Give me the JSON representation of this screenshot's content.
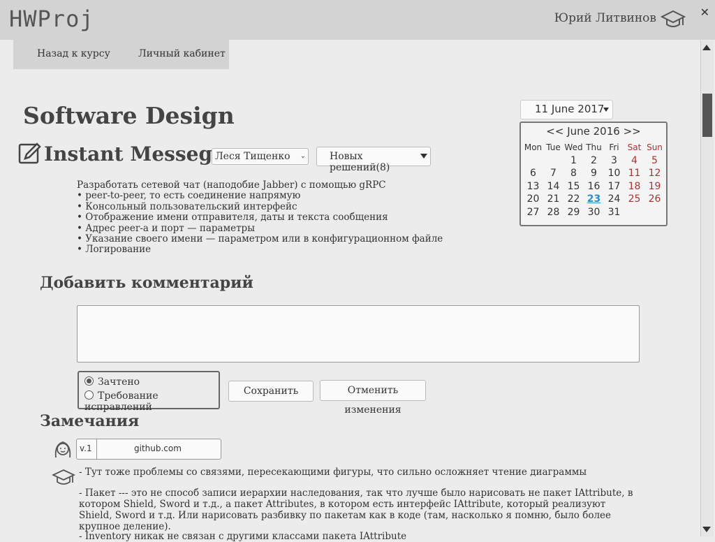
{
  "app": {
    "logo": "HWProj",
    "user_name": "Юрий Литвинов"
  },
  "nav": {
    "back_label": "Назад к курсу",
    "cabinet_label": "Личный кабинет"
  },
  "course": {
    "title": "Software Design"
  },
  "task": {
    "title": "Instant Messeger",
    "student_select": "Леся Тищенко",
    "solutions_select": "Новых решений(8)",
    "description": [
      "Разработать сетевой чат (наподобие Jabber) с помощью gRPC",
      "• peer-to-peer, то есть соединение напрямую",
      "• Консольный пользовательский интерфейс",
      "• Отображение имени отправителя, даты и текста сообщения",
      "• Адрес peer-а и порт — параметры",
      "• Указание своего имени — параметром или в конфигурационном файле",
      "• Логирование"
    ]
  },
  "date_picker": {
    "value": "11 June 2017"
  },
  "calendar": {
    "prev": "<<",
    "month_label": "June 2016",
    "next": ">>",
    "weekdays": [
      "Mon",
      "Tue",
      "Wed",
      "Thu",
      "Fri",
      "Sat",
      "Sun"
    ],
    "weeks": [
      [
        "",
        "",
        "",
        "1",
        "2",
        "3",
        "4",
        "5"
      ],
      [
        "6",
        "7",
        "8",
        "9",
        "10",
        "11",
        "12"
      ],
      [
        "13",
        "14",
        "15",
        "16",
        "17",
        "18",
        "19"
      ],
      [
        "20",
        "21",
        "22",
        "23",
        "24",
        "25",
        "26"
      ],
      [
        "27",
        "28",
        "29",
        "30",
        "31",
        "",
        ""
      ]
    ],
    "today": "23"
  },
  "comment": {
    "heading": "Добавить комментарий",
    "radio_accepted": "Зачтено",
    "radio_fix": "Требование исправлений",
    "save_label": "Сохранить",
    "cancel_label": "Отменить изменения"
  },
  "remarks": {
    "heading": "Замечания",
    "version": "v.1",
    "link": "github.com",
    "items": [
      "- Тут тоже проблемы со связями, пересекающими фигуры, что сильно осложняет чтение диаграммы",
      "- Пакет --- это не способ записи иерархии наследования, так что лучше было нарисовать не пакет IAttribute, в котором Shield, Sword и т.д., а пакет Attributes, в котором есть интерфейс IAttribute, который реализуют Shield, Sword и т.д. Или нарисовать разбивку по пакетам как в коде (там, насколько я помню, было более крупное деление).",
      "- Inventory никак не связан с другими классами пакета IAttribute"
    ]
  }
}
